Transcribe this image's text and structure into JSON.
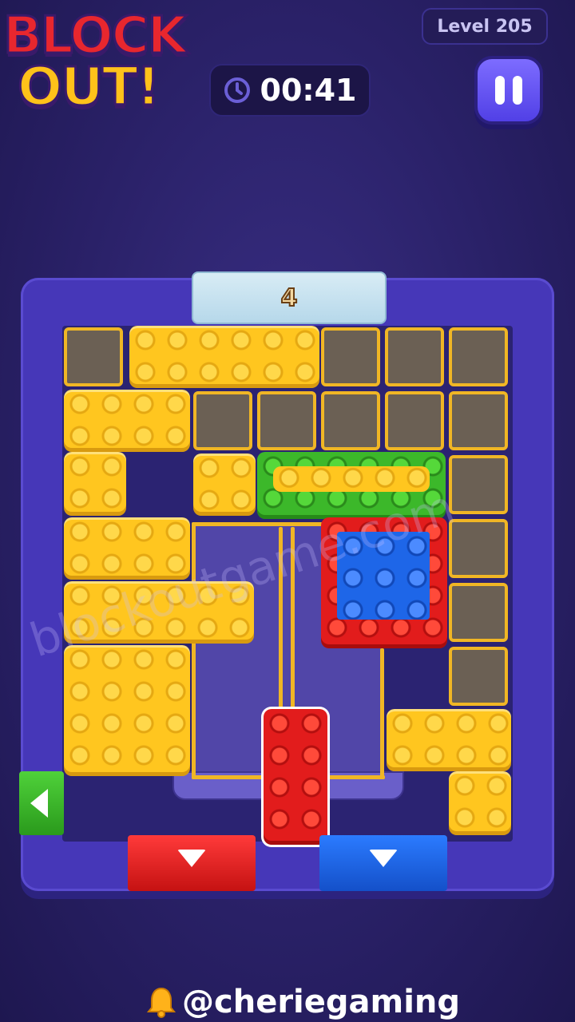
{
  "logo": {
    "line1": "BLOCK",
    "line2": "OUT!"
  },
  "header": {
    "level_label": "Level 205",
    "timer": "00:41"
  },
  "board": {
    "moves_counter": "4",
    "watermark": "blockoutgame.com"
  },
  "footer": {
    "handle": "@cheriegaming"
  },
  "colors": {
    "background": "#2a2168",
    "frame": "#4637b8",
    "yellow": "#ffc61f",
    "red": "#e21c1c",
    "green": "#3cb82a",
    "blue": "#1e66e8",
    "gold": "#f0b625"
  },
  "icons": [
    "clock-icon",
    "pause-icon",
    "down-arrow-icon",
    "left-arrow-icon",
    "bell-icon"
  ]
}
